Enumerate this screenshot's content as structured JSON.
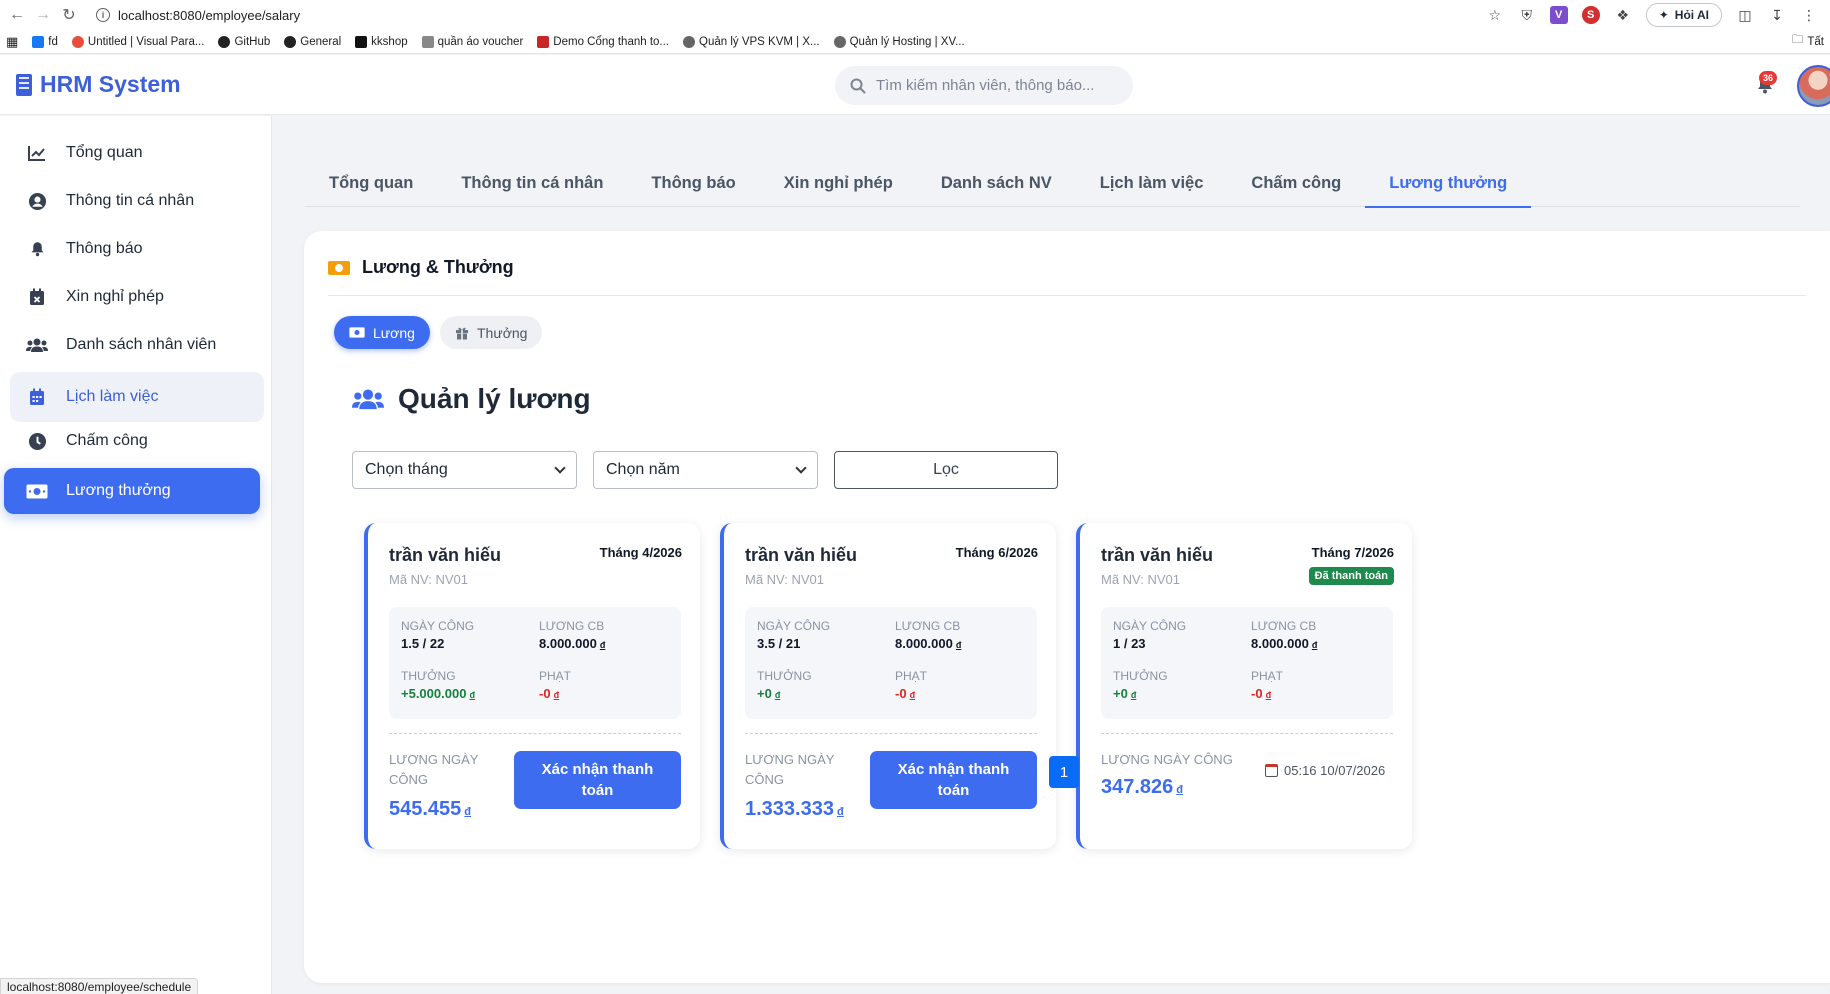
{
  "browser": {
    "url": "localhost:8080/employee/salary",
    "ai_button": "Hỏi AI",
    "bookmarks": [
      "fd",
      "Untitled | Visual Para...",
      "GitHub",
      "General",
      "kkshop",
      "quần áo voucher",
      "Demo Cổng thanh to...",
      "Quản lý VPS KVM | X...",
      "Quản lý Hosting | XV..."
    ],
    "bookmarks_right": "Tất",
    "status_url": "localhost:8080/employee/schedule"
  },
  "header": {
    "logo": "HRM System",
    "search_placeholder": "Tìm kiếm nhân viên, thông báo...",
    "notification_count": "36"
  },
  "sidebar": {
    "items": [
      {
        "label": "Tổng quan",
        "icon": "chart-line-icon"
      },
      {
        "label": "Thông tin cá nhân",
        "icon": "user-circle-icon"
      },
      {
        "label": "Thông báo",
        "icon": "bell-icon"
      },
      {
        "label": "Xin nghỉ phép",
        "icon": "calendar-x-icon"
      },
      {
        "label": "Danh sách nhân viên",
        "icon": "users-icon"
      },
      {
        "label": "Lịch làm việc",
        "icon": "calendar-icon"
      },
      {
        "label": "Chấm công",
        "icon": "clock-icon"
      },
      {
        "label": "Lương thưởng",
        "icon": "money-bill-icon"
      }
    ]
  },
  "tabs": [
    "Tổng quan",
    "Thông tin cá nhân",
    "Thông báo",
    "Xin nghỉ phép",
    "Danh sách NV",
    "Lịch làm việc",
    "Chấm công",
    "Lương thưởng"
  ],
  "panel": {
    "title": "Lương & Thưởng",
    "subtabs": [
      "Lương",
      "Thưởng"
    ],
    "section_title": "Quản lý lương",
    "select_month": "Chọn tháng",
    "select_year": "Chọn năm",
    "filter_button": "Lọc",
    "labels": {
      "days": "Ngày công",
      "base_salary": "Lương CB",
      "bonus": "Thưởng",
      "penalty": "Phạt",
      "daily_salary": "Lương ngày công",
      "currency": "đ",
      "confirm_button": "Xác nhận thanh toán",
      "paid": "Đã thanh toán"
    },
    "cards": [
      {
        "name": "trần văn hiếu",
        "employee_id": "Mã NV: NV01",
        "month": "Tháng 4/2026",
        "days": "1.5 / 22",
        "base_salary": "8.000.000",
        "bonus": "+5.000.000",
        "penalty": "-0",
        "amount": "545.455",
        "paid": false
      },
      {
        "name": "trần văn hiếu",
        "employee_id": "Mã NV: NV01",
        "month": "Tháng 6/2026",
        "days": "3.5 / 21",
        "base_salary": "8.000.000",
        "bonus": "+0",
        "penalty": "-0",
        "amount": "1.333.333",
        "paid": false
      },
      {
        "name": "trần văn hiếu",
        "employee_id": "Mã NV: NV01",
        "month": "Tháng 7/2026",
        "days": "1 / 23",
        "base_salary": "8.000.000",
        "bonus": "+0",
        "penalty": "-0",
        "amount": "347.826",
        "paid": true,
        "paid_time": "05:16 10/07/2026"
      }
    ],
    "page": "1"
  },
  "colors": {
    "primary": "#3d6cf0",
    "success": "#1e8a4c",
    "danger": "#dc2626",
    "brand": "#3d5fd9"
  }
}
